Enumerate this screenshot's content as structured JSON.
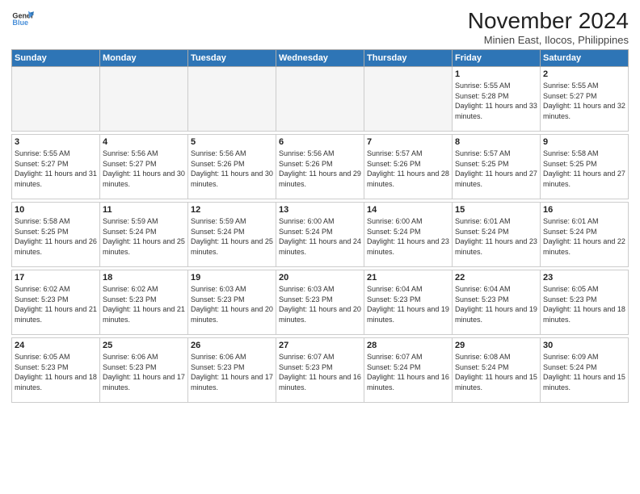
{
  "logo": {
    "line1": "General",
    "line2": "Blue"
  },
  "title": "November 2024",
  "location": "Minien East, Ilocos, Philippines",
  "weekdays": [
    "Sunday",
    "Monday",
    "Tuesday",
    "Wednesday",
    "Thursday",
    "Friday",
    "Saturday"
  ],
  "weeks": [
    [
      {
        "day": "",
        "sunrise": "",
        "sunset": "",
        "daylight": "",
        "empty": true
      },
      {
        "day": "",
        "sunrise": "",
        "sunset": "",
        "daylight": "",
        "empty": true
      },
      {
        "day": "",
        "sunrise": "",
        "sunset": "",
        "daylight": "",
        "empty": true
      },
      {
        "day": "",
        "sunrise": "",
        "sunset": "",
        "daylight": "",
        "empty": true
      },
      {
        "day": "",
        "sunrise": "",
        "sunset": "",
        "daylight": "",
        "empty": true
      },
      {
        "day": "1",
        "sunrise": "Sunrise: 5:55 AM",
        "sunset": "Sunset: 5:28 PM",
        "daylight": "Daylight: 11 hours and 33 minutes.",
        "empty": false
      },
      {
        "day": "2",
        "sunrise": "Sunrise: 5:55 AM",
        "sunset": "Sunset: 5:27 PM",
        "daylight": "Daylight: 11 hours and 32 minutes.",
        "empty": false
      }
    ],
    [
      {
        "day": "3",
        "sunrise": "Sunrise: 5:55 AM",
        "sunset": "Sunset: 5:27 PM",
        "daylight": "Daylight: 11 hours and 31 minutes.",
        "empty": false
      },
      {
        "day": "4",
        "sunrise": "Sunrise: 5:56 AM",
        "sunset": "Sunset: 5:27 PM",
        "daylight": "Daylight: 11 hours and 30 minutes.",
        "empty": false
      },
      {
        "day": "5",
        "sunrise": "Sunrise: 5:56 AM",
        "sunset": "Sunset: 5:26 PM",
        "daylight": "Daylight: 11 hours and 30 minutes.",
        "empty": false
      },
      {
        "day": "6",
        "sunrise": "Sunrise: 5:56 AM",
        "sunset": "Sunset: 5:26 PM",
        "daylight": "Daylight: 11 hours and 29 minutes.",
        "empty": false
      },
      {
        "day": "7",
        "sunrise": "Sunrise: 5:57 AM",
        "sunset": "Sunset: 5:26 PM",
        "daylight": "Daylight: 11 hours and 28 minutes.",
        "empty": false
      },
      {
        "day": "8",
        "sunrise": "Sunrise: 5:57 AM",
        "sunset": "Sunset: 5:25 PM",
        "daylight": "Daylight: 11 hours and 27 minutes.",
        "empty": false
      },
      {
        "day": "9",
        "sunrise": "Sunrise: 5:58 AM",
        "sunset": "Sunset: 5:25 PM",
        "daylight": "Daylight: 11 hours and 27 minutes.",
        "empty": false
      }
    ],
    [
      {
        "day": "10",
        "sunrise": "Sunrise: 5:58 AM",
        "sunset": "Sunset: 5:25 PM",
        "daylight": "Daylight: 11 hours and 26 minutes.",
        "empty": false
      },
      {
        "day": "11",
        "sunrise": "Sunrise: 5:59 AM",
        "sunset": "Sunset: 5:24 PM",
        "daylight": "Daylight: 11 hours and 25 minutes.",
        "empty": false
      },
      {
        "day": "12",
        "sunrise": "Sunrise: 5:59 AM",
        "sunset": "Sunset: 5:24 PM",
        "daylight": "Daylight: 11 hours and 25 minutes.",
        "empty": false
      },
      {
        "day": "13",
        "sunrise": "Sunrise: 6:00 AM",
        "sunset": "Sunset: 5:24 PM",
        "daylight": "Daylight: 11 hours and 24 minutes.",
        "empty": false
      },
      {
        "day": "14",
        "sunrise": "Sunrise: 6:00 AM",
        "sunset": "Sunset: 5:24 PM",
        "daylight": "Daylight: 11 hours and 23 minutes.",
        "empty": false
      },
      {
        "day": "15",
        "sunrise": "Sunrise: 6:01 AM",
        "sunset": "Sunset: 5:24 PM",
        "daylight": "Daylight: 11 hours and 23 minutes.",
        "empty": false
      },
      {
        "day": "16",
        "sunrise": "Sunrise: 6:01 AM",
        "sunset": "Sunset: 5:24 PM",
        "daylight": "Daylight: 11 hours and 22 minutes.",
        "empty": false
      }
    ],
    [
      {
        "day": "17",
        "sunrise": "Sunrise: 6:02 AM",
        "sunset": "Sunset: 5:23 PM",
        "daylight": "Daylight: 11 hours and 21 minutes.",
        "empty": false
      },
      {
        "day": "18",
        "sunrise": "Sunrise: 6:02 AM",
        "sunset": "Sunset: 5:23 PM",
        "daylight": "Daylight: 11 hours and 21 minutes.",
        "empty": false
      },
      {
        "day": "19",
        "sunrise": "Sunrise: 6:03 AM",
        "sunset": "Sunset: 5:23 PM",
        "daylight": "Daylight: 11 hours and 20 minutes.",
        "empty": false
      },
      {
        "day": "20",
        "sunrise": "Sunrise: 6:03 AM",
        "sunset": "Sunset: 5:23 PM",
        "daylight": "Daylight: 11 hours and 20 minutes.",
        "empty": false
      },
      {
        "day": "21",
        "sunrise": "Sunrise: 6:04 AM",
        "sunset": "Sunset: 5:23 PM",
        "daylight": "Daylight: 11 hours and 19 minutes.",
        "empty": false
      },
      {
        "day": "22",
        "sunrise": "Sunrise: 6:04 AM",
        "sunset": "Sunset: 5:23 PM",
        "daylight": "Daylight: 11 hours and 19 minutes.",
        "empty": false
      },
      {
        "day": "23",
        "sunrise": "Sunrise: 6:05 AM",
        "sunset": "Sunset: 5:23 PM",
        "daylight": "Daylight: 11 hours and 18 minutes.",
        "empty": false
      }
    ],
    [
      {
        "day": "24",
        "sunrise": "Sunrise: 6:05 AM",
        "sunset": "Sunset: 5:23 PM",
        "daylight": "Daylight: 11 hours and 18 minutes.",
        "empty": false
      },
      {
        "day": "25",
        "sunrise": "Sunrise: 6:06 AM",
        "sunset": "Sunset: 5:23 PM",
        "daylight": "Daylight: 11 hours and 17 minutes.",
        "empty": false
      },
      {
        "day": "26",
        "sunrise": "Sunrise: 6:06 AM",
        "sunset": "Sunset: 5:23 PM",
        "daylight": "Daylight: 11 hours and 17 minutes.",
        "empty": false
      },
      {
        "day": "27",
        "sunrise": "Sunrise: 6:07 AM",
        "sunset": "Sunset: 5:23 PM",
        "daylight": "Daylight: 11 hours and 16 minutes.",
        "empty": false
      },
      {
        "day": "28",
        "sunrise": "Sunrise: 6:07 AM",
        "sunset": "Sunset: 5:24 PM",
        "daylight": "Daylight: 11 hours and 16 minutes.",
        "empty": false
      },
      {
        "day": "29",
        "sunrise": "Sunrise: 6:08 AM",
        "sunset": "Sunset: 5:24 PM",
        "daylight": "Daylight: 11 hours and 15 minutes.",
        "empty": false
      },
      {
        "day": "30",
        "sunrise": "Sunrise: 6:09 AM",
        "sunset": "Sunset: 5:24 PM",
        "daylight": "Daylight: 11 hours and 15 minutes.",
        "empty": false
      }
    ]
  ]
}
